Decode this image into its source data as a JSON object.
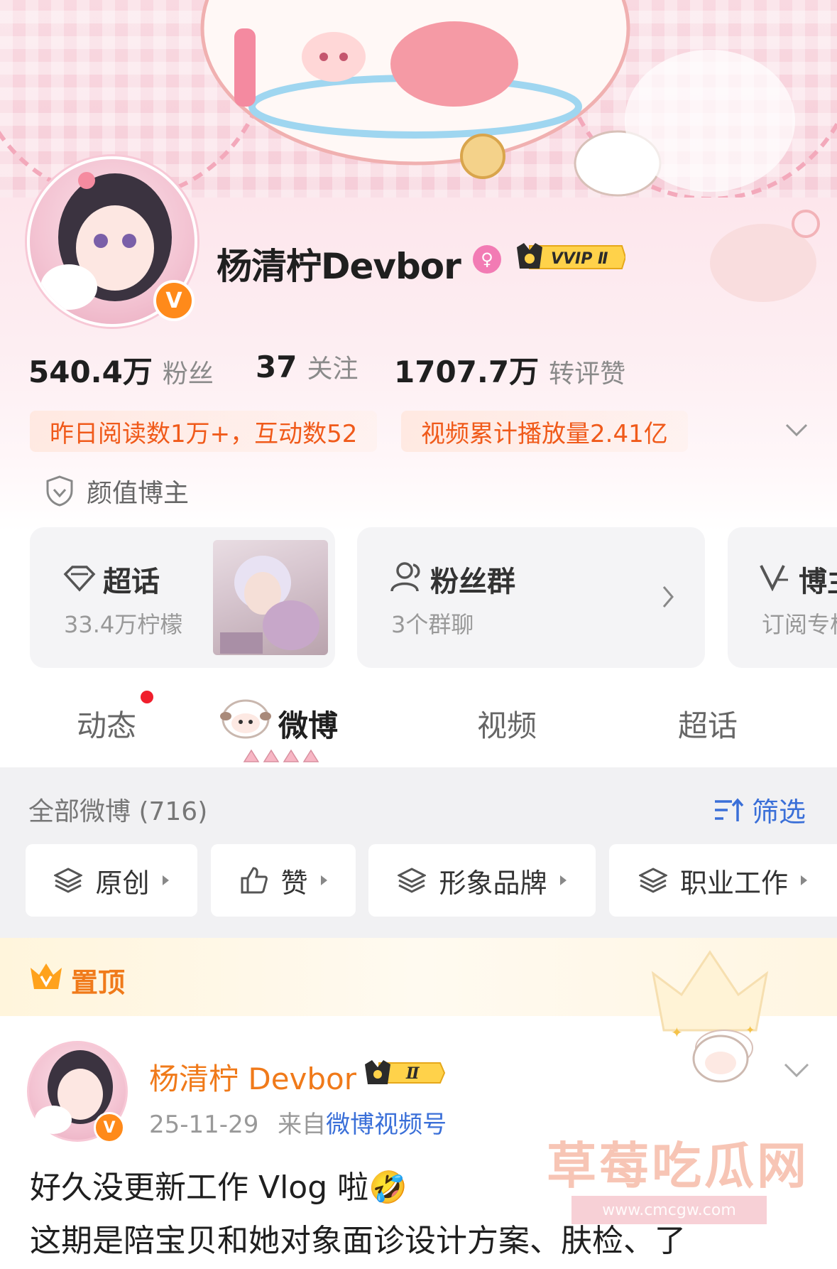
{
  "profile": {
    "name": "杨清柠Devbor",
    "vip_label": "VVIP Ⅱ",
    "verified_badge": "V",
    "gender_icon": "female-icon"
  },
  "stats": [
    {
      "value": "540.4万",
      "label": "粉丝"
    },
    {
      "value": "37",
      "label": "关注"
    },
    {
      "value": "1707.7万",
      "label": "转评赞"
    }
  ],
  "tags": [
    "昨日阅读数1万+，互动数52",
    "视频累计播放量2.41亿"
  ],
  "certification": "颜值博主",
  "cards": {
    "supertopic": {
      "title": "超话",
      "sub": "33.4万柠檬"
    },
    "fan_group": {
      "title": "粉丝群",
      "sub": "3个群聊"
    },
    "blogger": {
      "title": "博主",
      "sub": "订阅专栏"
    }
  },
  "tabs": [
    {
      "label": "动态",
      "active": false
    },
    {
      "label": "微博",
      "active": true
    },
    {
      "label": "视频",
      "active": false
    },
    {
      "label": "超话",
      "active": false
    }
  ],
  "feed": {
    "all_label": "全部微博 (716)",
    "filter_label": "筛选",
    "chips": [
      "原创",
      "赞",
      "形象品牌",
      "职业工作"
    ]
  },
  "pinned": {
    "label": "置顶",
    "author": "杨清柠 Devbor",
    "author_badge": "Ⅱ",
    "date": "25-11-29",
    "from_prefix": "来自",
    "source": "微博视频号",
    "line1": "好久没更新工作 Vlog 啦🤣",
    "line2": "这期是陪宝贝和她对象面诊设计方案、肤检、了"
  },
  "watermark": {
    "text": "草莓吃瓜网",
    "url": "www.cmcgw.com"
  },
  "colors": {
    "accent_orange": "#f07a1a",
    "link_blue": "#3a6fd8",
    "pink": "#f6cdd8"
  }
}
